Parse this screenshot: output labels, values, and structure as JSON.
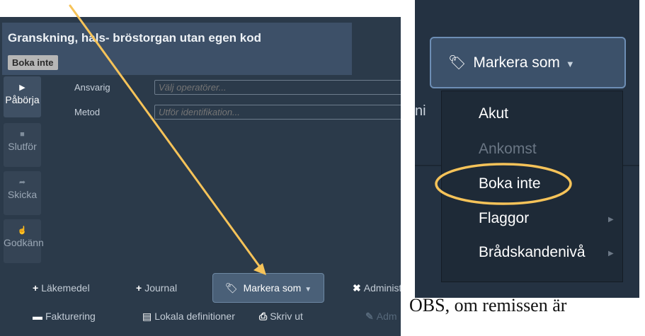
{
  "header": {
    "title": "Granskning, hals- bröstorgan utan egen kod",
    "badge": "Boka inte"
  },
  "sidebar": {
    "buttons": [
      {
        "icon": "play-icon",
        "label": "Påbörja",
        "enabled": true
      },
      {
        "icon": "stop-icon",
        "label": "Slutför",
        "enabled": false
      },
      {
        "icon": "share-icon",
        "label": "Skicka",
        "enabled": false
      },
      {
        "icon": "thumbs-up-icon",
        "label": "Godkänn",
        "enabled": false
      }
    ]
  },
  "form": {
    "ansvarig_label": "Ansvarig",
    "ansvarig_placeholder": "Välj operatörer...",
    "metod_label": "Metod",
    "metod_placeholder": "Utför identifikation..."
  },
  "toolbar": {
    "lakemedel": "Läkemedel",
    "journal": "Journal",
    "markera": "Markera som",
    "administ": "Administ",
    "fakturering": "Fakturering",
    "lokala": "Lokala definitioner",
    "skriv_ut": "Skriv ut",
    "adm": "Adm"
  },
  "right_panel": {
    "partial_text": "ni",
    "button_label": "Markera som",
    "menu": [
      {
        "label": "Akut",
        "enabled": true,
        "submenu": false
      },
      {
        "label": "Ankomst",
        "enabled": false,
        "submenu": false
      },
      {
        "label": "Boka inte",
        "enabled": true,
        "submenu": false,
        "highlighted": true
      },
      {
        "label": "Flaggor",
        "enabled": true,
        "submenu": true
      },
      {
        "label": "Brådskandenivå",
        "enabled": true,
        "submenu": true
      }
    ]
  },
  "footnote": "OBS, om remissen är",
  "colors": {
    "annotation": "#f6c359",
    "panel_bg": "#2b3a4a",
    "header_bg": "#3d5068"
  }
}
